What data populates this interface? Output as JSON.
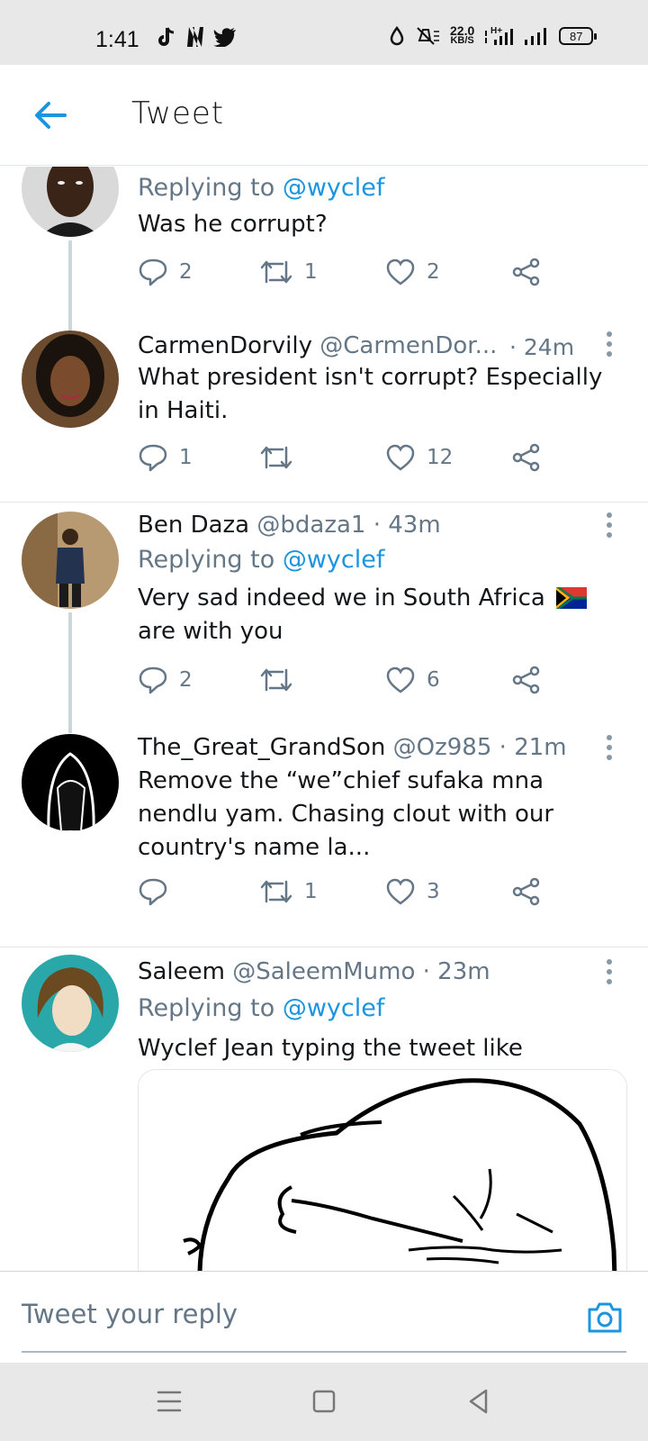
{
  "status_bar": {
    "time": "1:41",
    "net_speed_value": "22.0",
    "net_speed_unit": "KB/S",
    "network_type": "H+",
    "battery": "87"
  },
  "header": {
    "title": "Tweet"
  },
  "tweets": [
    {
      "name": "",
      "handle": "",
      "replying_prefix": "Replying to",
      "replying_to": "@wyclef",
      "text": "Was he corrupt?",
      "replies": "2",
      "retweets": "1",
      "likes": "2"
    },
    {
      "name": "CarmenDorvily",
      "handle": "@CarmenDor...",
      "time": "· 24m",
      "text": "What president isn't corrupt? Especially in Haiti.",
      "replies": "1",
      "retweets": "",
      "likes": "12"
    },
    {
      "name": "Ben Daza",
      "handle": "@bdaza1",
      "time": "· 43m",
      "replying_prefix": "Replying to",
      "replying_to": "@wyclef",
      "text": "Very sad indeed we in South Africa",
      "text_line2": "are with you",
      "replies": "2",
      "retweets": "",
      "likes": "6"
    },
    {
      "name": "The_Great_GrandSon",
      "handle": "@Oz985",
      "time": "· 21m",
      "text": "Remove the “we”chief sufaka mna nendlu yam. Chasing clout with our country's name la...",
      "replies": "",
      "retweets": "1",
      "likes": "3"
    },
    {
      "name": "Saleem",
      "handle": "@SaleemMumo",
      "time": "· 23m",
      "replying_prefix": "Replying to",
      "replying_to": "@wyclef",
      "text": "Wyclef Jean typing the tweet like"
    }
  ],
  "reply_bar": {
    "placeholder": "Tweet your reply"
  },
  "colors": {
    "accent": "#1b95e0",
    "secondary_text": "#657786",
    "divider": "#e1e8ed"
  },
  "icons": [
    "back-arrow-icon",
    "reply-icon",
    "retweet-icon",
    "like-icon",
    "share-icon",
    "more-icon",
    "camera-icon",
    "south-africa-flag-icon"
  ]
}
